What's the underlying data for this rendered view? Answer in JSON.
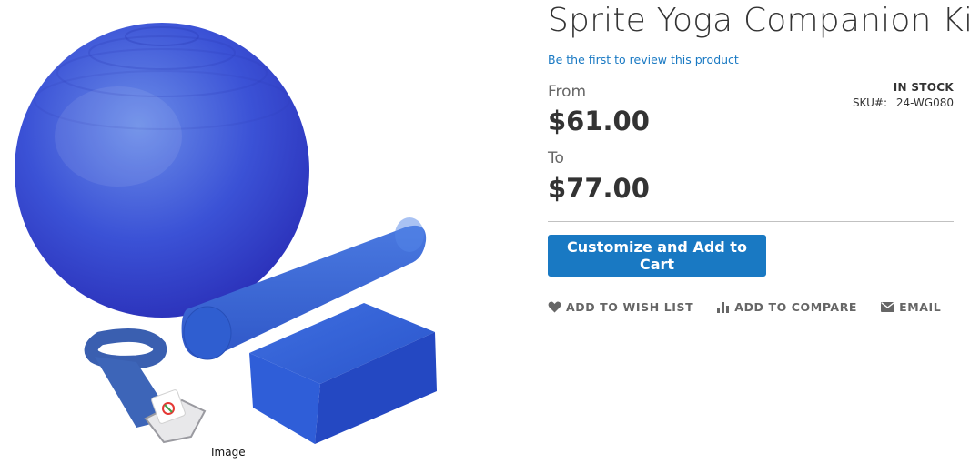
{
  "product": {
    "title": "Sprite Yoga Companion Kit",
    "review_link": "Be the first to review this product",
    "image_caption": "Image"
  },
  "price": {
    "from_label": "From",
    "from_value": "$61.00",
    "to_label": "To",
    "to_value": "$77.00"
  },
  "stock": {
    "status": "IN STOCK",
    "sku_label": "SKU#:",
    "sku_value": "24-WG080"
  },
  "actions": {
    "add_to_cart": "Customize and Add to Cart",
    "wishlist": "ADD TO WISH LIST",
    "compare": "ADD TO COMPARE",
    "email": "EMAIL",
    "wishlist_icon": "heart-icon",
    "compare_icon": "bar-chart-icon",
    "email_icon": "envelope-icon"
  },
  "colors": {
    "accent": "#1979c3",
    "text": "#333333",
    "muted": "#666666",
    "link": "#1979c3"
  }
}
